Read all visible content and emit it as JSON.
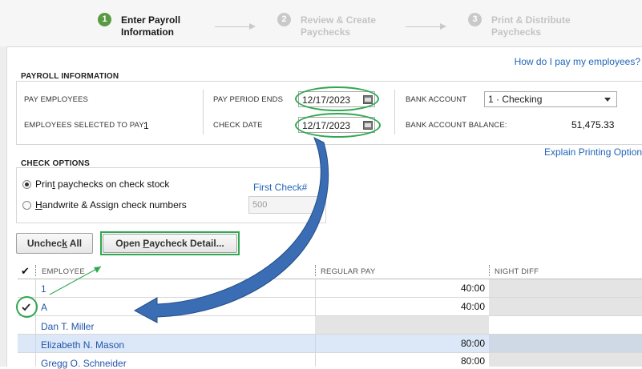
{
  "stepper": {
    "steps": [
      {
        "num": "1",
        "label_line1": "Enter Payroll",
        "label_line2": "Information",
        "state": "active"
      },
      {
        "num": "2",
        "label_line1": "Review & Create",
        "label_line2": "Paychecks",
        "state": "inactive"
      },
      {
        "num": "3",
        "label_line1": "Print & Distribute",
        "label_line2": "Paychecks",
        "state": "inactive"
      }
    ]
  },
  "help_link": "How do I pay my employees?",
  "payroll_info": {
    "title": "PAYROLL INFORMATION",
    "pay_employees_label": "PAY EMPLOYEES",
    "employees_selected_label": "EMPLOYEES SELECTED TO PAY:",
    "employees_selected_value": "1",
    "pay_period_ends_label": "PAY PERIOD ENDS",
    "pay_period_ends_value": "12/17/2023",
    "check_date_label": "CHECK DATE",
    "check_date_value": "12/17/2023",
    "bank_account_label": "BANK ACCOUNT",
    "bank_account_value": "1 · Checking",
    "bank_balance_label": "BANK ACCOUNT BALANCE:",
    "bank_balance_value": "51,475.33"
  },
  "explain_printing_link": "Explain Printing Option",
  "check_options": {
    "title": "CHECK OPTIONS",
    "option_print_pre": "Prin",
    "option_print_u": "t",
    "option_print_post": " paychecks on check stock",
    "option_handwrite_pre": "",
    "option_handwrite_u": "H",
    "option_handwrite_post": "andwrite & Assign check numbers",
    "selected": "print",
    "first_check_label": "First Check#",
    "first_check_value": "500"
  },
  "buttons": {
    "uncheck_all_pre": "Unchec",
    "uncheck_all_u": "k",
    "uncheck_all_post": " All",
    "open_detail_pre": "Open ",
    "open_detail_u": "P",
    "open_detail_post": "aycheck Detail..."
  },
  "table": {
    "check_header": "✔",
    "columns": [
      "EMPLOYEE",
      "REGULAR PAY",
      "NIGHT DIFF"
    ],
    "rows": [
      {
        "checked": false,
        "name": "1",
        "regular_pay": "40:00",
        "night_diff": "",
        "highlight": false
      },
      {
        "checked": true,
        "name": "A",
        "regular_pay": "40:00",
        "night_diff": "",
        "highlight": false
      },
      {
        "checked": false,
        "name": "Dan T. Miller",
        "regular_pay": "",
        "night_diff": "",
        "highlight": false
      },
      {
        "checked": false,
        "name": "Elizabeth N. Mason",
        "regular_pay": "80:00",
        "night_diff": "",
        "highlight": true
      },
      {
        "checked": false,
        "name": "Gregg O. Schneider",
        "regular_pay": "80:00",
        "night_diff": "",
        "highlight": false
      }
    ]
  },
  "colors": {
    "annotation_green": "#2fa84f",
    "annotation_arrow_blue": "#3a6db3",
    "link_blue": "#2266bb",
    "row_highlight": "#dce8f7",
    "disabled_cell": "#e4e4e4"
  }
}
